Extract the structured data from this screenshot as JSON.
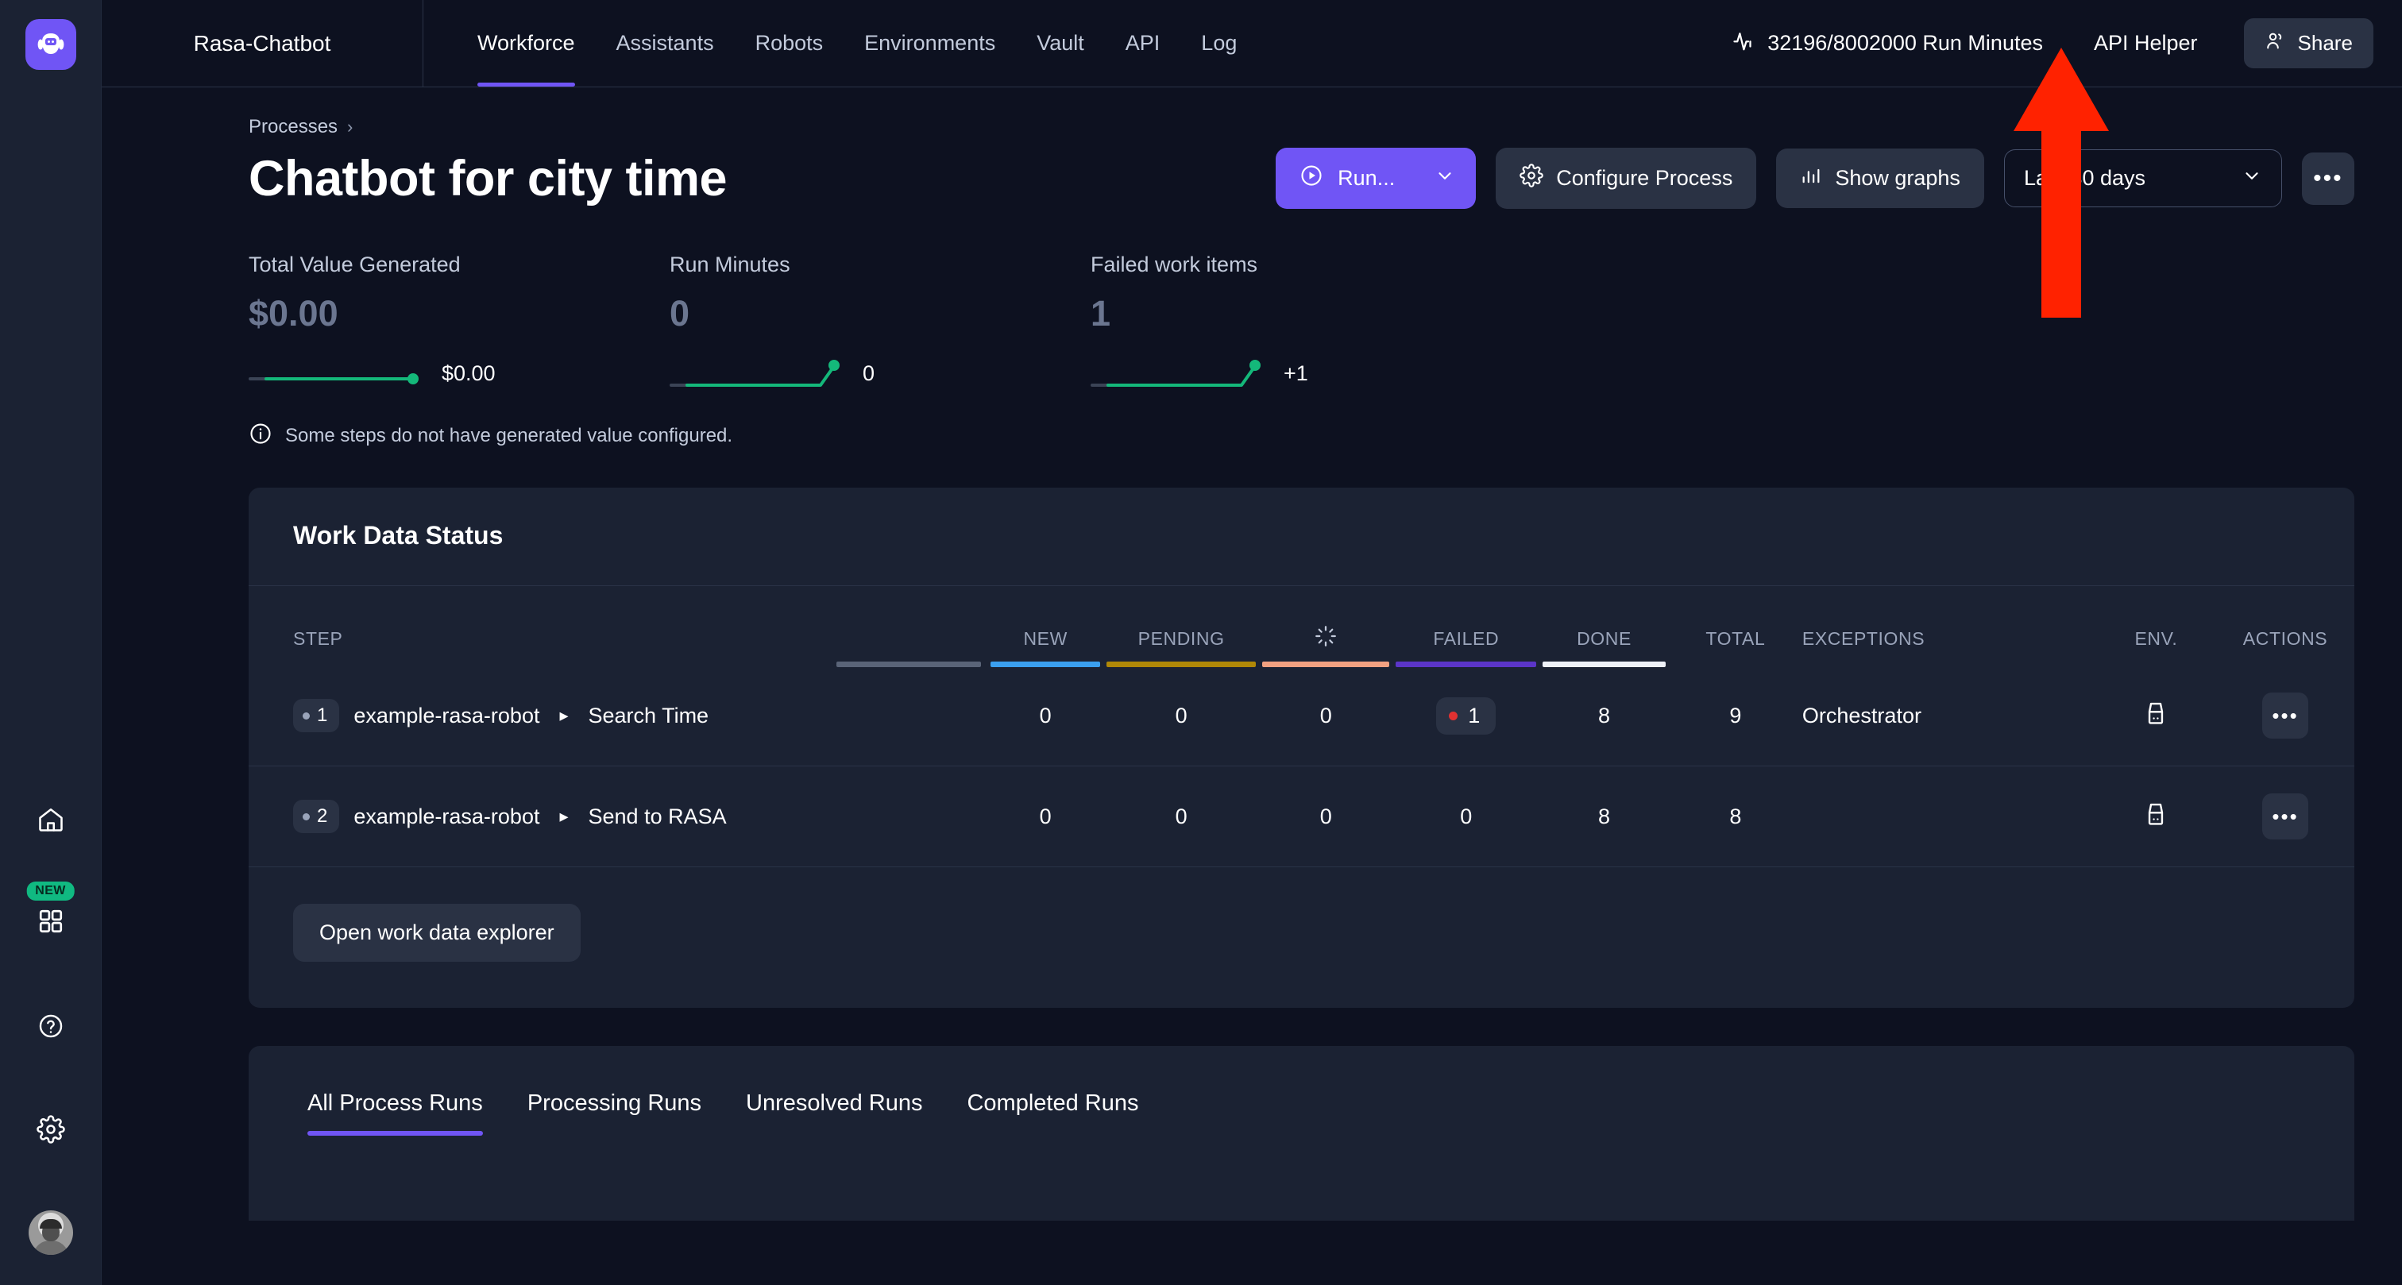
{
  "sidebar": {
    "logo_icon": "robot-logo-icon",
    "items": [
      {
        "icon": "home-icon",
        "name": "home"
      },
      {
        "icon": "apps-grid-icon",
        "name": "apps",
        "badge": "NEW"
      },
      {
        "icon": "help-circle-icon",
        "name": "help"
      },
      {
        "icon": "gear-icon",
        "name": "settings"
      },
      {
        "icon": "avatar",
        "name": "user-profile"
      }
    ]
  },
  "topbar": {
    "workspace_name": "Rasa-Chatbot",
    "nav": [
      {
        "label": "Workforce",
        "active": true
      },
      {
        "label": "Assistants",
        "active": false
      },
      {
        "label": "Robots",
        "active": false
      },
      {
        "label": "Environments",
        "active": false
      },
      {
        "label": "Vault",
        "active": false
      },
      {
        "label": "API",
        "active": false
      },
      {
        "label": "Log",
        "active": false
      }
    ],
    "run_minutes": "32196/8002000 Run Minutes",
    "run_minutes_icon": "activity-pulse-icon",
    "api_helper": "API Helper",
    "share_label": "Share",
    "share_icon": "people-icon"
  },
  "page": {
    "breadcrumb": "Processes",
    "title": "Chatbot for city time",
    "actions": {
      "run_label": "Run...",
      "run_icon": "play-circle-icon",
      "configure_label": "Configure Process",
      "configure_icon": "gear-icon",
      "graphs_label": "Show graphs",
      "graphs_icon": "bar-chart-icon",
      "date_range": "Last 30 days",
      "more_label": "•••"
    }
  },
  "metrics": [
    {
      "label": "Total Value Generated",
      "value": "$0.00",
      "delta": "$0.00"
    },
    {
      "label": "Run Minutes",
      "value": "0",
      "delta": "0"
    },
    {
      "label": "Failed work items",
      "value": "1",
      "delta": "+1"
    }
  ],
  "note": {
    "icon": "info-circle-icon",
    "text": "Some steps do not have generated value configured."
  },
  "work_data_status": {
    "title": "Work Data Status",
    "columns": [
      {
        "label": "STEP",
        "color": "#5a6478"
      },
      {
        "label": "NEW",
        "color": "#3ba0f0"
      },
      {
        "label": "PENDING",
        "color": "#b08807"
      },
      {
        "label": "",
        "icon": "spinner-icon",
        "color": "#f2a181"
      },
      {
        "label": "FAILED",
        "color": "#5b35c8"
      },
      {
        "label": "DONE",
        "color": "#eef1f8"
      },
      {
        "label": "TOTAL",
        "color": ""
      },
      {
        "label": "EXCEPTIONS",
        "color": ""
      },
      {
        "label": "ENV.",
        "color": ""
      },
      {
        "label": "ACTIONS",
        "color": ""
      }
    ],
    "rows": [
      {
        "index": "1",
        "robot": "example-rasa-robot",
        "step": "Search Time",
        "new": "0",
        "pending": "0",
        "in_progress": "0",
        "failed": "1",
        "failed_alert": true,
        "done": "8",
        "total": "9",
        "exceptions": "Orchestrator",
        "env_icon": "server-icon",
        "actions_label": "•••"
      },
      {
        "index": "2",
        "robot": "example-rasa-robot",
        "step": "Send to RASA",
        "new": "0",
        "pending": "0",
        "in_progress": "0",
        "failed": "0",
        "failed_alert": false,
        "done": "8",
        "total": "8",
        "exceptions": "",
        "env_icon": "server-icon",
        "actions_label": "•••"
      }
    ],
    "explorer_button": "Open work data explorer"
  },
  "runs_tabs": [
    {
      "label": "All Process Runs",
      "active": true
    },
    {
      "label": "Processing Runs",
      "active": false
    },
    {
      "label": "Unresolved Runs",
      "active": false
    },
    {
      "label": "Completed Runs",
      "active": false
    }
  ],
  "colors": {
    "accent": "#7055f5",
    "page_bg": "#0d1120",
    "card_bg": "#1b2233",
    "sidebar_bg": "#1b2233",
    "spark_green": "#14b87a",
    "danger": "#e03131",
    "annotation_arrow": "#ff2200"
  }
}
